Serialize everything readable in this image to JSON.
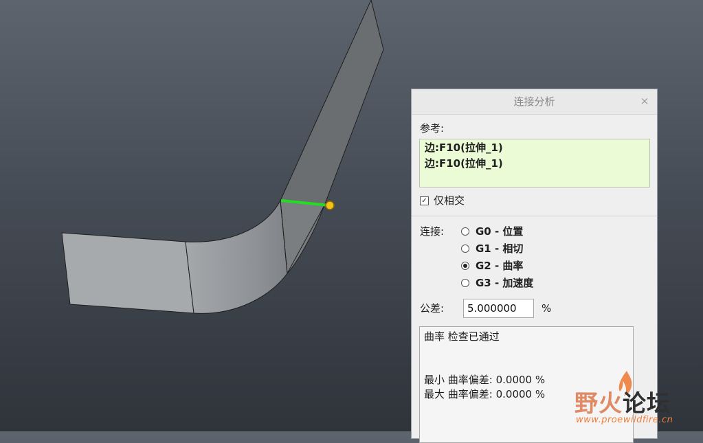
{
  "dialog": {
    "title": "连接分析",
    "close_glyph": "×",
    "reference_label": "参考:",
    "references": [
      "边:F10(拉伸_1)",
      "边:F10(拉伸_1)"
    ],
    "only_intersect": {
      "label": "仅相交",
      "checked": true
    },
    "connection_label": "连接:",
    "connection_options": [
      {
        "label": "G0 - 位置",
        "selected": false
      },
      {
        "label": "G1 - 相切",
        "selected": false
      },
      {
        "label": "G2 - 曲率",
        "selected": true
      },
      {
        "label": "G3 - 加速度",
        "selected": false
      }
    ],
    "tolerance_label": "公差:",
    "tolerance_value": "5.000000",
    "tolerance_unit": "%",
    "result": {
      "status": "曲率 检查已通过",
      "min_line": "最小 曲率偏差: 0.0000 %",
      "max_line": "最大 曲率偏差: 0.0000 %"
    }
  },
  "watermark": {
    "wild": "野",
    "fire": "火",
    "forum": "论坛",
    "url": "www.proewildfire.cn"
  },
  "colors": {
    "accent_edge": "#22dd22",
    "marker": "#f2c21b",
    "reference_bg": "#eafbd6"
  }
}
